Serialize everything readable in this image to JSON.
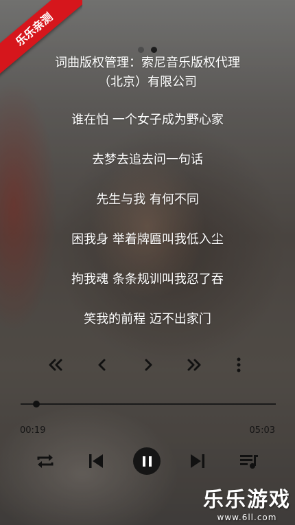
{
  "ribbon": {
    "text": "乐乐亲测"
  },
  "pager": {
    "count": 2,
    "active": 1
  },
  "lyrics": {
    "credit_line1": "词曲版权管理：索尼音乐版权代理",
    "credit_line2": "（北京）有限公司",
    "lines": [
      "谁在怕 一个女子成为野心家",
      "去梦去追去问一句话",
      "先生与我 有何不同",
      "困我身 举着牌匾叫我低入尘",
      "拘我魂 条条规训叫我忍了吞",
      "笑我的前程 迈不出家门"
    ]
  },
  "player": {
    "current_time": "00:19",
    "duration": "05:03",
    "progress": 0.063
  },
  "watermark": {
    "title": "乐乐游戏",
    "url": "www.6ll.com"
  },
  "colors": {
    "icon": "#111111",
    "ribbon": "#d6161c",
    "lyric": "#ffffff"
  }
}
